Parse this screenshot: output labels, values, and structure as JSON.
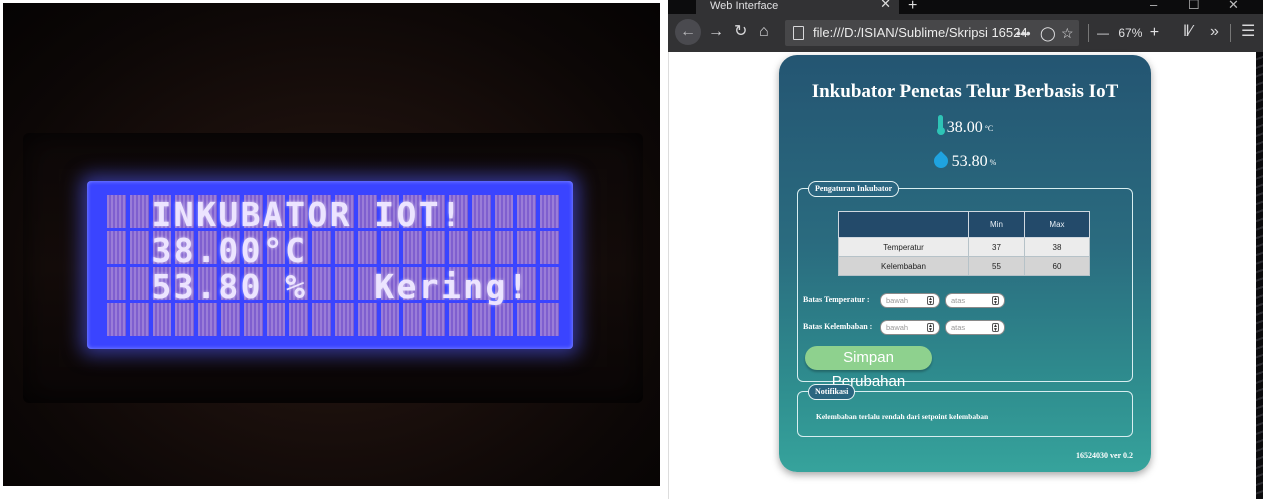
{
  "photo": {
    "lcd_lines": [
      "  INKUBATOR IOT!  ",
      "  38.00°C        ",
      "  53.80 %   Kering!"
    ]
  },
  "browser": {
    "tab_title": "Web Interface",
    "tab_close": "✕",
    "new_tab": "+",
    "url": "file:///D:/ISIAN/Sublime/Skripsi 16524",
    "url_more": "•••",
    "zoom": "67%",
    "zoom_minus": "—",
    "zoom_plus": "+",
    "win_min": "–",
    "win_max": "☐",
    "win_close": "✕"
  },
  "page": {
    "title": "Inkubator Penetas Telur Berbasis IoT",
    "temperature": "38.00",
    "temperature_unit": "°C",
    "humidity": "53.80",
    "humidity_unit": "%",
    "settings_legend": "Pengaturan Inkubator",
    "table": {
      "headers": [
        "",
        "Min",
        "Max"
      ],
      "rows": [
        [
          "Temperatur",
          "37",
          "38"
        ],
        [
          "Kelembaban",
          "55",
          "60"
        ]
      ]
    },
    "temp_limit_label": "Batas Temperatur :",
    "hum_limit_label": "Batas Kelembaban :",
    "placeholder_low": "bawah",
    "placeholder_high": "atas",
    "save_button": "Simpan Perubahan",
    "notif_legend": "Notifikasi",
    "notif_message": "Kelembaban terlalu rendah dari setpoint kelembaban",
    "version": "16524030 ver 0.2"
  },
  "icons": [
    "back-icon",
    "forward-icon",
    "reload-icon",
    "home-icon",
    "page-icon",
    "pocket-icon",
    "star-icon",
    "library-icon",
    "overflow-icon",
    "menu-icon",
    "thermometer-icon",
    "water-drop-icon"
  ]
}
